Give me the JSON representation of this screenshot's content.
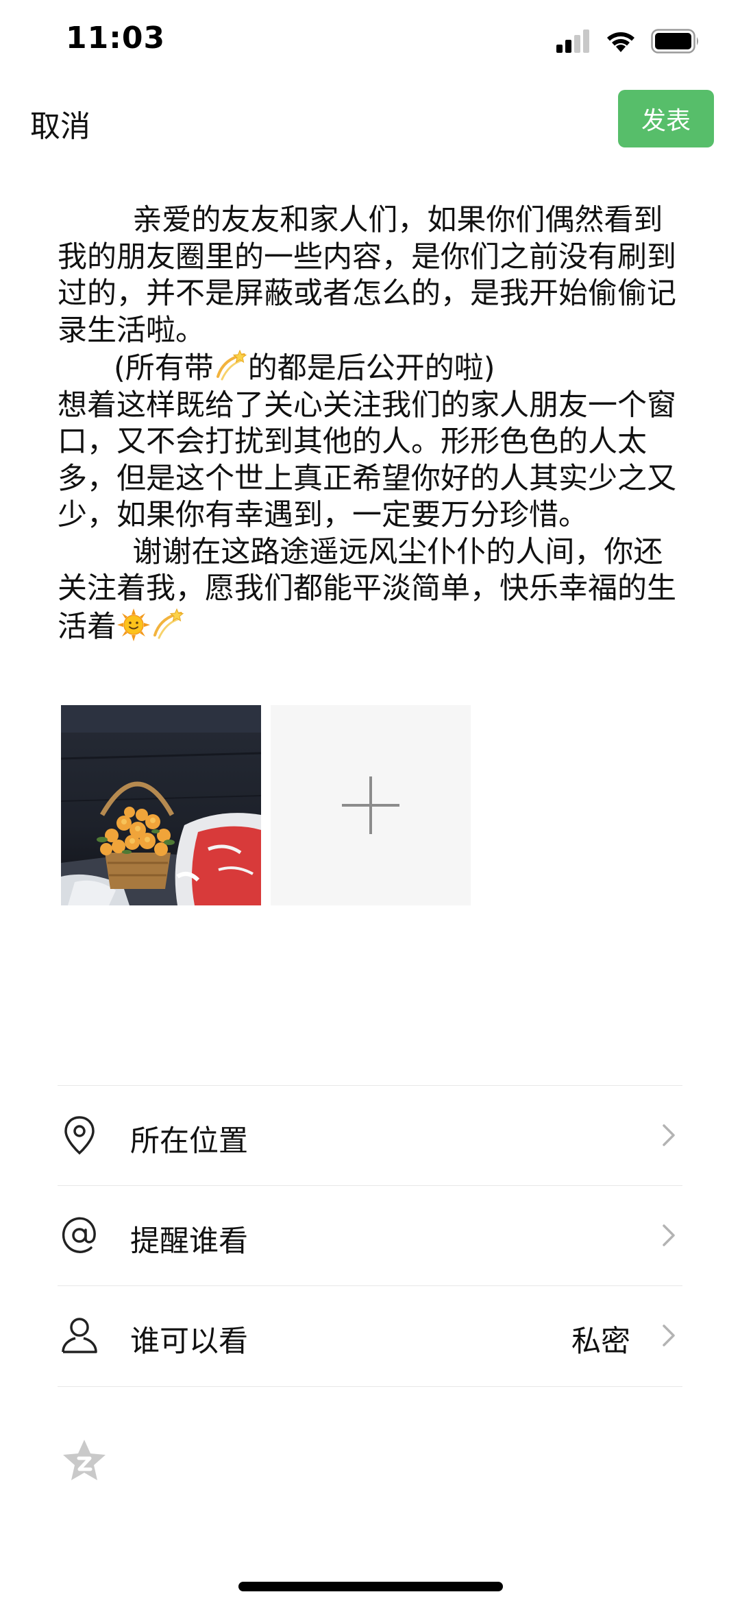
{
  "status_bar": {
    "time": "11:03",
    "icons": [
      "signal-icon",
      "wifi-icon",
      "battery-icon"
    ]
  },
  "nav": {
    "cancel_label": "取消",
    "publish_label": "发表",
    "publish_color": "#57be6a"
  },
  "post": {
    "paragraphs": [
      "        亲爱的友友和家人们，如果你们偶然看到我的朋友圈里的一些内容，是你们之前没有刷到过的，并不是屏蔽或者怎么的，是我开始偷偷记录生活啦。",
      "      (所有带",
      "的都是后公开的啦)",
      "想着这样既给了关心关注我们的家人朋友一个窗口，又不会打扰到其他的人。形形色色的人太多，但是这个世上真正希望你好的人其实少之又少，如果你有幸遇到，一定要万分珍惜。",
      "        谢谢在这路途遥远风尘仆仆的人间，你还关注着我，愿我们都能平淡简单，快乐幸福的生活着"
    ],
    "emojis": [
      "dizzy-star-emoji",
      "sun-face-emoji",
      "dizzy-star-emoji"
    ]
  },
  "photos": {
    "count": 1,
    "add_icon": "plus-icon"
  },
  "options": [
    {
      "icon": "location-pin-icon",
      "label": "所在位置",
      "value": ""
    },
    {
      "icon": "at-sign-icon",
      "label": "提醒谁看",
      "value": ""
    },
    {
      "icon": "person-icon",
      "label": "谁可以看",
      "value": "私密"
    }
  ],
  "footer": {
    "star_icon": "star-icon"
  }
}
